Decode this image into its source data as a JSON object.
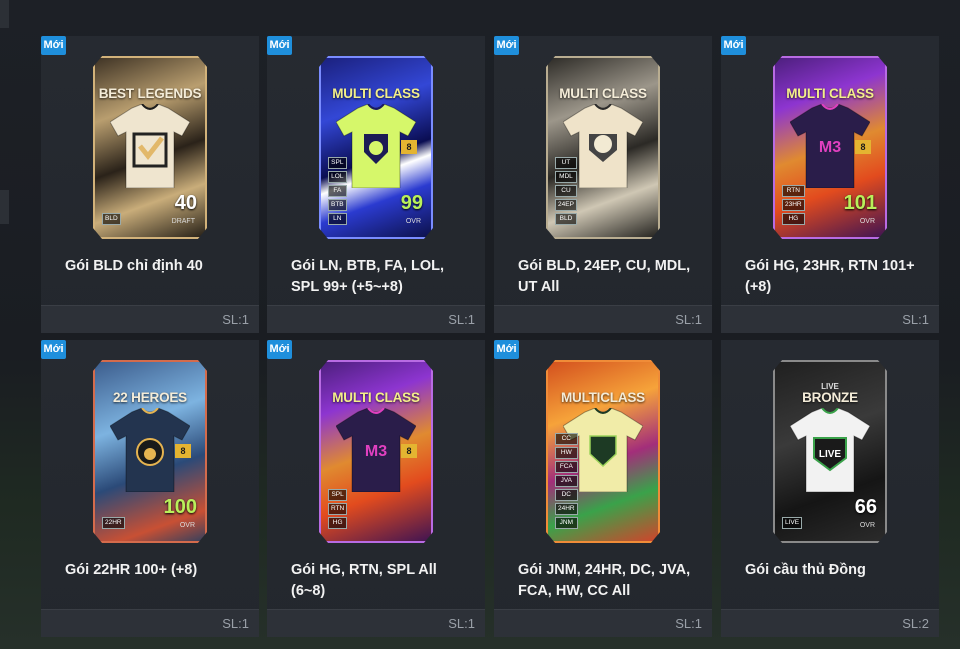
{
  "new_badge": "Mới",
  "packs": [
    {
      "name": "Gói BLD chỉ định 40",
      "qty": "SL:1",
      "card": {
        "title": "BEST LEGENDS",
        "tag": "",
        "level": "",
        "ovr": "40",
        "ovr_label": "DRAFT",
        "tags": [
          "BLD"
        ],
        "theme": "gold",
        "emblem": "check"
      }
    },
    {
      "name": "Gói LN, BTB, FA, LOL, SPL 99+ (+5~+8)",
      "qty": "SL:1",
      "card": {
        "title": "MULTI CLASS",
        "tag": "",
        "level": "8",
        "ovr": "99",
        "ovr_label": "OVR",
        "tags": [
          "SPL",
          "LOL",
          "FA",
          "BTB",
          "LN"
        ],
        "theme": "blue",
        "emblem": "lion"
      }
    },
    {
      "name": "Gói BLD, 24EP, CU, MDL, UT All",
      "qty": "SL:1",
      "card": {
        "title": "MULTI CLASS",
        "tag": "",
        "level": "",
        "ovr": "",
        "ovr_label": "",
        "tags": [
          "UT",
          "MDL",
          "CU",
          "24EP",
          "BLD"
        ],
        "theme": "silver",
        "emblem": "ball"
      }
    },
    {
      "name": "Gói HG, 23HR, RTN 101+ (+8)",
      "qty": "SL:1",
      "card": {
        "title": "MULTI CLASS",
        "tag": "",
        "level": "8",
        "ovr": "101",
        "ovr_label": "OVR",
        "tags": [
          "RTN",
          "23HR",
          "HG"
        ],
        "theme": "purple",
        "emblem": "wing"
      }
    },
    {
      "name": "Gói 22HR 100+ (+8)",
      "qty": "SL:1",
      "card": {
        "title": "22 HEROES",
        "tag": "",
        "level": "8",
        "ovr": "100",
        "ovr_label": "OVR",
        "tags": [
          "22HR"
        ],
        "theme": "heroes",
        "emblem": "crest"
      }
    },
    {
      "name": "Gói HG, RTN, SPL All (6~8)",
      "qty": "SL:1",
      "card": {
        "title": "MULTI CLASS",
        "tag": "",
        "level": "8",
        "ovr": "",
        "ovr_label": "",
        "tags": [
          "SPL",
          "RTN",
          "HG"
        ],
        "theme": "purple",
        "emblem": "wing"
      }
    },
    {
      "name": "Gói JNM, 24HR, DC, JVA, FCA, HW, CC All",
      "qty": "SL:1",
      "card": {
        "title": "MULTICLASS",
        "tag": "",
        "level": "",
        "ovr": "",
        "ovr_label": "",
        "tags": [
          "CC",
          "HW",
          "FCA",
          "JVA",
          "DC",
          "24HR",
          "JNM"
        ],
        "theme": "orange",
        "emblem": "shield"
      }
    },
    {
      "name": "Gói cầu thủ Đồng",
      "qty": "SL:2",
      "card": {
        "title": "BRONZE",
        "tag": "LIVE",
        "level": "",
        "ovr": "66",
        "ovr_label": "OVR",
        "tags": [
          "LIVE"
        ],
        "theme": "dark",
        "emblem": "live"
      }
    }
  ],
  "new_flags": [
    true,
    true,
    true,
    true,
    true,
    true,
    true,
    false
  ]
}
